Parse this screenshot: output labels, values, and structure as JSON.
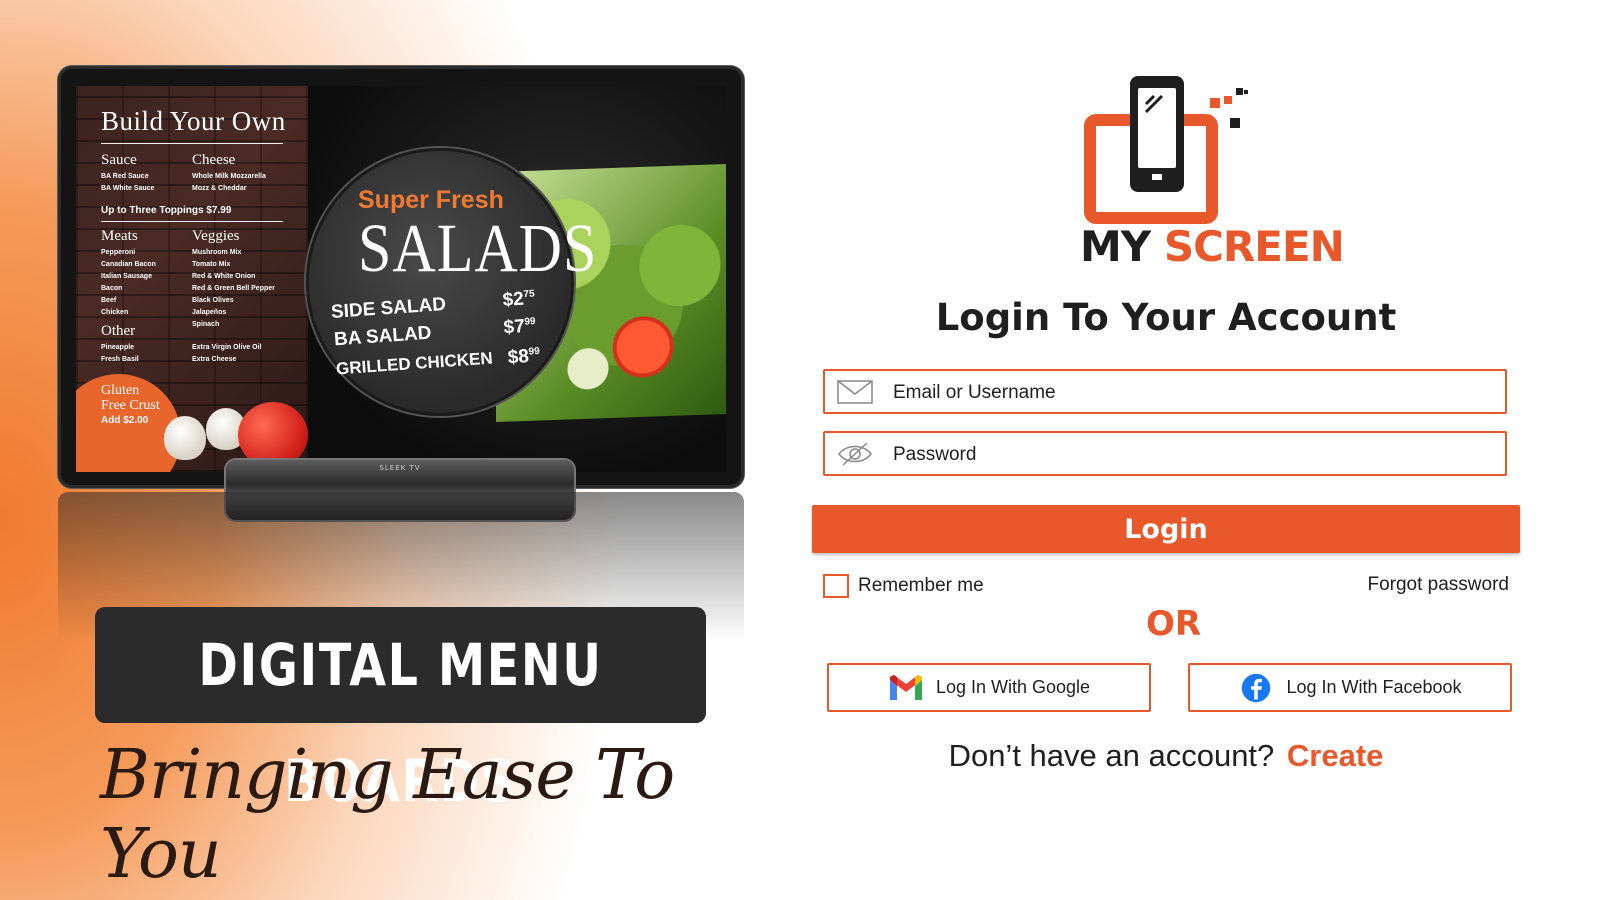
{
  "tv": {
    "menu": {
      "title": "Build Your Own",
      "sauce_head": "Sauce",
      "sauce_items": [
        "BA Red Sauce",
        "BA White Sauce"
      ],
      "cheese_head": "Cheese",
      "cheese_items": [
        "Whole Milk Mozzarella",
        "Mozz & Cheddar"
      ],
      "toppings": "Up to Three Toppings $7.99",
      "meats_head": "Meats",
      "meats_items": [
        "Pepperoni",
        "Canadian Bacon",
        "Italian Sausage",
        "Bacon",
        "Beef",
        "Chicken"
      ],
      "veggies_head": "Veggies",
      "veggies_items": [
        "Mushroom Mix",
        "Tomato Mix",
        "Red & White Onion",
        "Red & Green Bell Pepper",
        "Black Olives",
        "Jalapeños",
        "Spinach"
      ],
      "other_head": "Other",
      "other_items": [
        "Pineapple",
        "Fresh Basil"
      ],
      "other_items2": [
        "Extra Virgin Olive Oil",
        "Extra Cheese"
      ],
      "gluten_line1": "Gluten",
      "gluten_line2": "Free Crust",
      "gluten_line3": "Add $2.00"
    },
    "salads": {
      "super_fresh": "Super Fresh",
      "title": "SALADS",
      "rows": [
        {
          "name": "SIDE SALAD",
          "price": "$2",
          "cents": "75"
        },
        {
          "name": "BA SALAD",
          "price": "$7",
          "cents": "99"
        },
        {
          "name": "GRILLED CHICKEN",
          "price": "$8",
          "cents": "99"
        }
      ]
    },
    "stand_label": "SLEEK TV"
  },
  "left": {
    "headline": "DIGITAL MENU BOARDS",
    "tagline": "Bringing Ease To You"
  },
  "brand": {
    "my": "MY",
    "screen": "SCREEN"
  },
  "login": {
    "title": "Login To Your Account",
    "email_placeholder": "Email or Username",
    "password_placeholder": "Password",
    "button": "Login",
    "remember": "Remember me",
    "remember_checked": false,
    "forgot": "Forgot password",
    "or": "OR",
    "google": "Log In With Google",
    "facebook": "Log In With Facebook",
    "no_account": "Don’t have an account?",
    "create": "Create"
  },
  "colors": {
    "accent": "#e8582a",
    "dark": "#1f1f1f",
    "facebook": "#1877f2"
  }
}
